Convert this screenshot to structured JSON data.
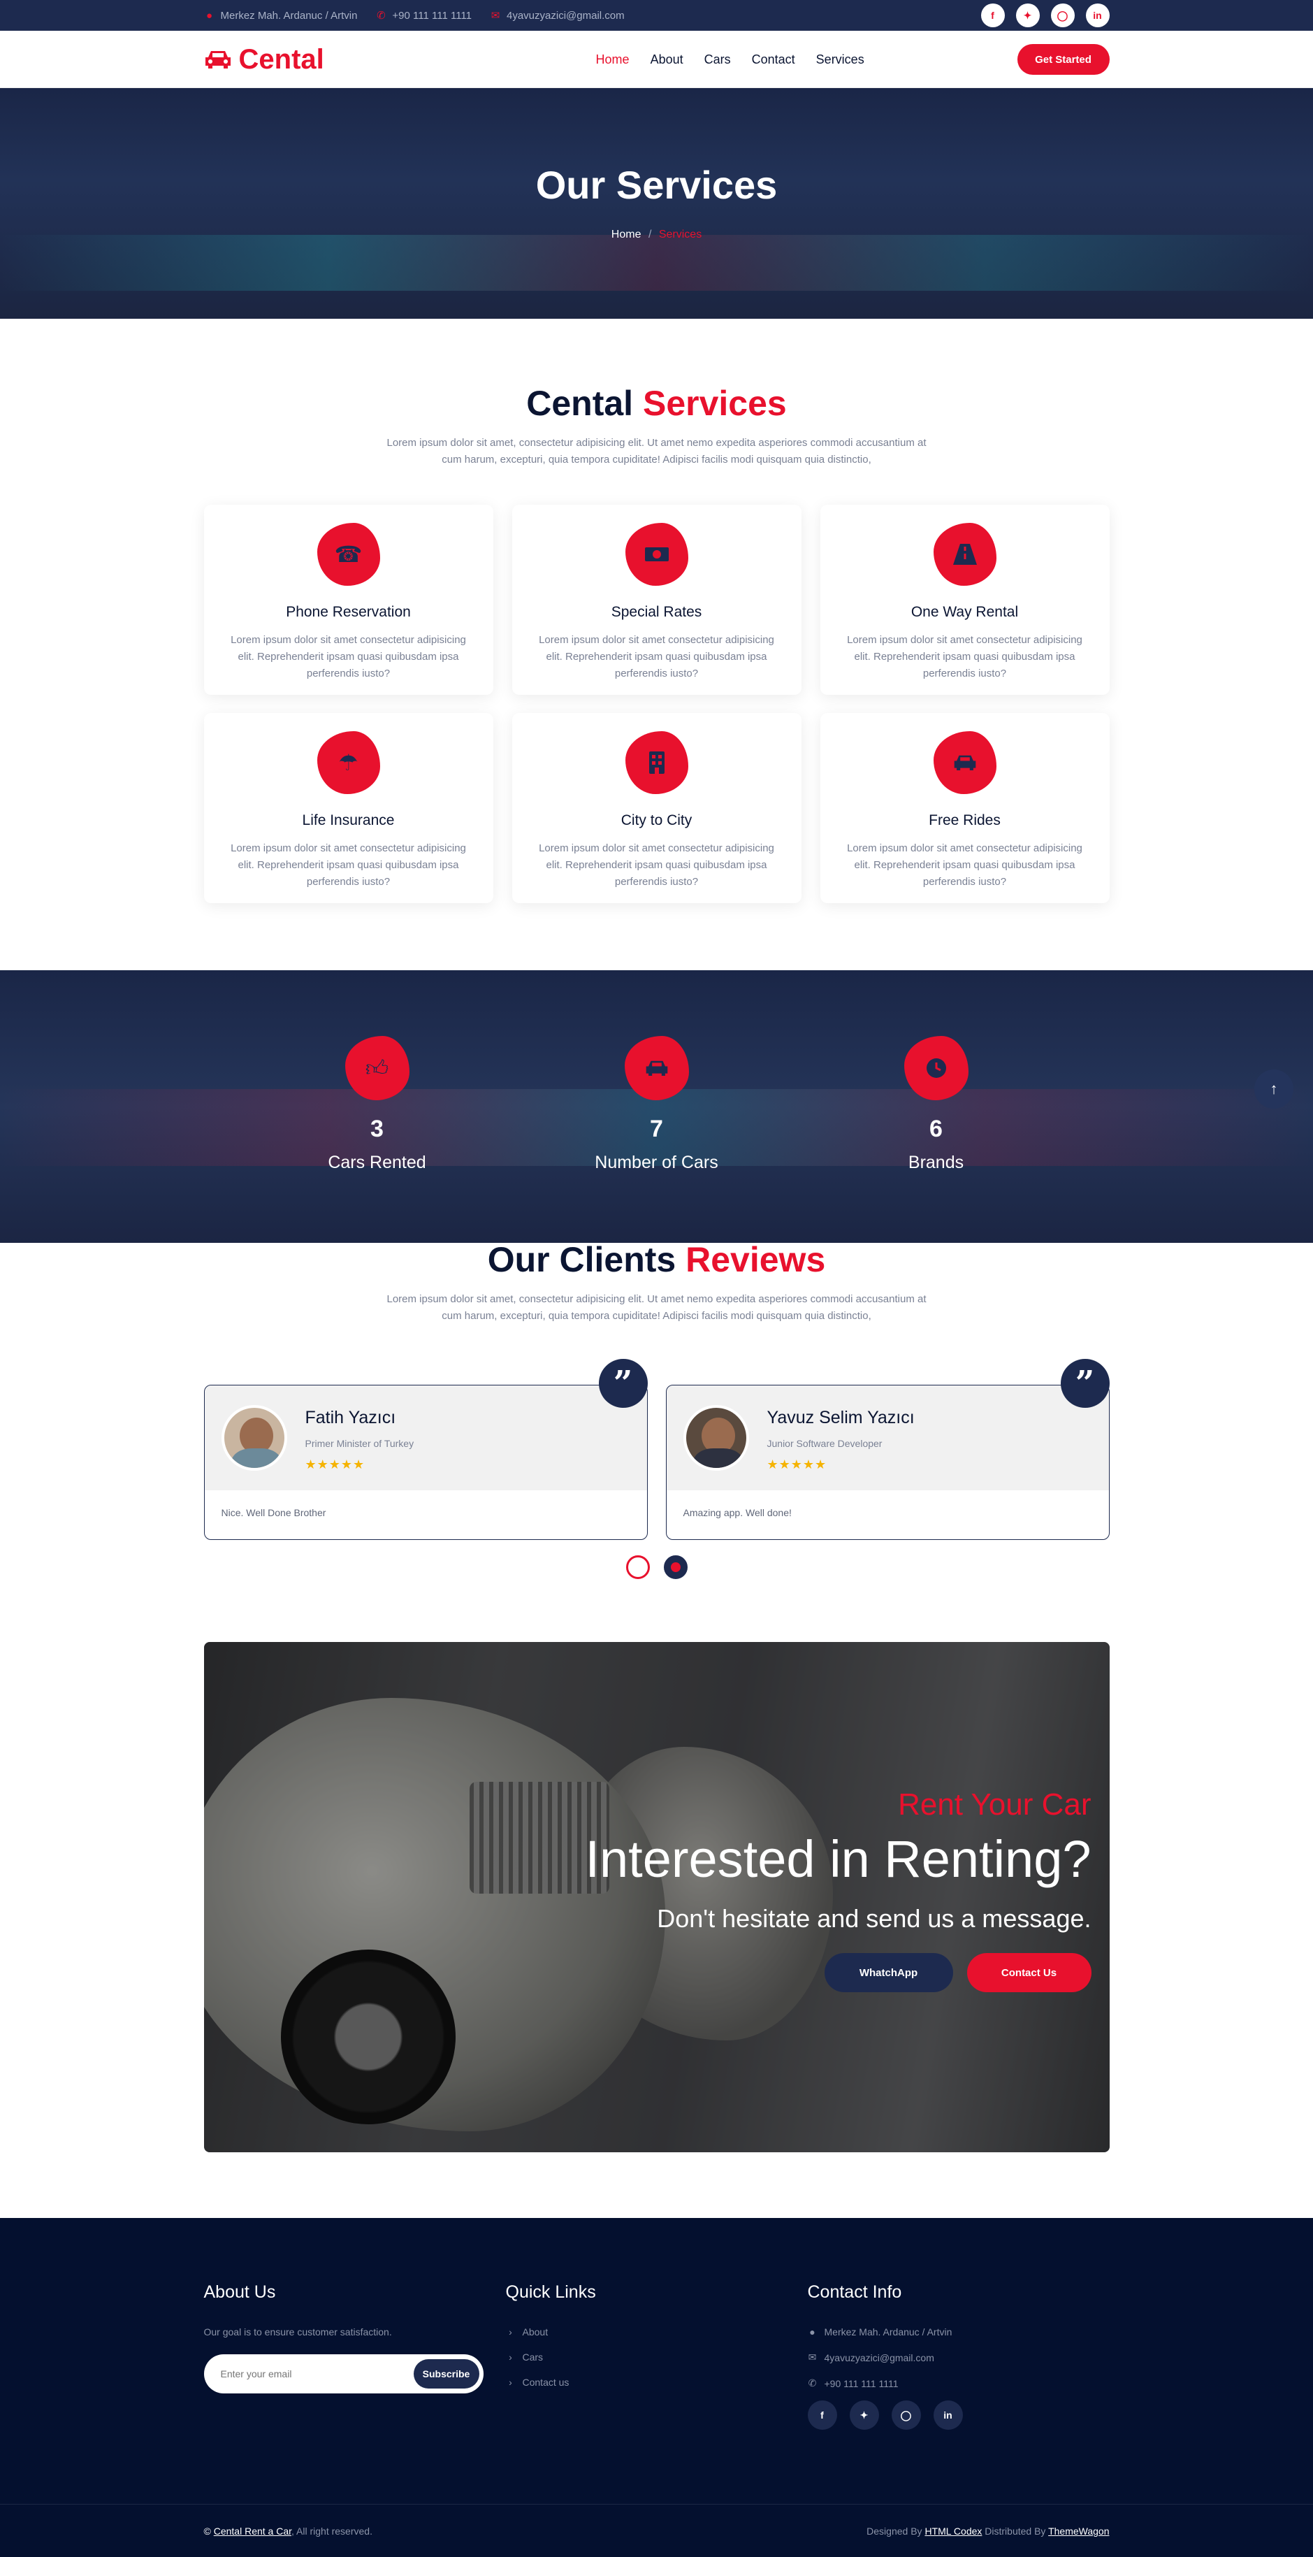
{
  "topbar": {
    "address": "Merkez Mah. Ardanuc / Artvin",
    "phone": "+90 111 111 1111",
    "email": "4yavuzyazici@gmail.com",
    "social": [
      "f",
      "t",
      "ig",
      "in"
    ]
  },
  "nav": {
    "brand": "Cental",
    "items": [
      "Home",
      "About",
      "Cars",
      "Contact",
      "Services"
    ],
    "active": "Home",
    "cta": "Get Started"
  },
  "hero": {
    "title": "Our Services",
    "crumb_home": "Home",
    "crumb_sep": "/",
    "crumb_current": "Services"
  },
  "services": {
    "title_a": "Cental",
    "title_b": "Services",
    "desc": "Lorem ipsum dolor sit amet, consectetur adipisicing elit. Ut amet nemo expedita asperiores commodi accusantium at cum harum, excepturi, quia tempora cupiditate! Adipisci facilis modi quisquam quia distinctio,",
    "cards": [
      {
        "title": "Phone Reservation",
        "icon": "phone-icon",
        "text": "Lorem ipsum dolor sit amet consectetur adipisicing elit. Reprehenderit ipsam quasi quibusdam ipsa perferendis iusto?"
      },
      {
        "title": "Special Rates",
        "icon": "money-icon",
        "text": "Lorem ipsum dolor sit amet consectetur adipisicing elit. Reprehenderit ipsam quasi quibusdam ipsa perferendis iusto?"
      },
      {
        "title": "One Way Rental",
        "icon": "road-icon",
        "text": "Lorem ipsum dolor sit amet consectetur adipisicing elit. Reprehenderit ipsam quasi quibusdam ipsa perferendis iusto?"
      },
      {
        "title": "Life Insurance",
        "icon": "umbrella-icon",
        "text": "Lorem ipsum dolor sit amet consectetur adipisicing elit. Reprehenderit ipsam quasi quibusdam ipsa perferendis iusto?"
      },
      {
        "title": "City to City",
        "icon": "building-icon",
        "text": "Lorem ipsum dolor sit amet consectetur adipisicing elit. Reprehenderit ipsam quasi quibusdam ipsa perferendis iusto?"
      },
      {
        "title": "Free Rides",
        "icon": "car-icon",
        "text": "Lorem ipsum dolor sit amet consectetur adipisicing elit. Reprehenderit ipsam quasi quibusdam ipsa perferendis iusto?"
      }
    ]
  },
  "counters": [
    {
      "value": "3",
      "label": "Cars Rented",
      "icon": "thumbs-up-icon"
    },
    {
      "value": "7",
      "label": "Number of Cars",
      "icon": "car-icon"
    },
    {
      "value": "6",
      "label": "Brands",
      "icon": "clock-icon"
    }
  ],
  "reviews": {
    "title_a": "Our Clients",
    "title_b": "Reviews",
    "desc": "Lorem ipsum dolor sit amet, consectetur adipisicing elit. Ut amet nemo expedita asperiores commodi accusantium at cum harum, excepturi, quia tempora cupiditate! Adipisci facilis modi quisquam quia distinctio,",
    "items": [
      {
        "name": "Fatih Yazıcı",
        "role": "Primer Minister of Turkey",
        "stars": "★★★★★",
        "text": "Nice. Well Done Brother"
      },
      {
        "name": "Yavuz Selim Yazıcı",
        "role": "Junior Software Developer",
        "stars": "★★★★★",
        "text": "Amazing app. Well done!"
      }
    ]
  },
  "banner": {
    "subtitle": "Rent Your Car",
    "title": "Interested in Renting?",
    "line": "Don't hesitate and send us a message.",
    "btn_whatsapp": "WhatchApp",
    "btn_contact": "Contact Us"
  },
  "footer": {
    "about_title": "About Us",
    "about_text": "Our goal is to ensure customer satisfaction.",
    "email_placeholder": "Enter your email",
    "subscribe": "Subscribe",
    "links_title": "Quick Links",
    "links": [
      "About",
      "Cars",
      "Contact us"
    ],
    "contact_title": "Contact Info",
    "address": "Merkez Mah. Ardanuc / Artvin",
    "email": "4yavuzyazici@gmail.com",
    "phone": "+90 111 111 1111",
    "copyright_link": "Cental Rent a Car",
    "copyright_rest": ", All right reserved.",
    "designed_by": "Designed By",
    "designer": "HTML Codex",
    "distributed_by": "Distributed By",
    "distributor": "ThemeWagon"
  },
  "colors": {
    "accent": "#e8112d",
    "navy": "#1d2a4f",
    "dark": "#04102f"
  }
}
